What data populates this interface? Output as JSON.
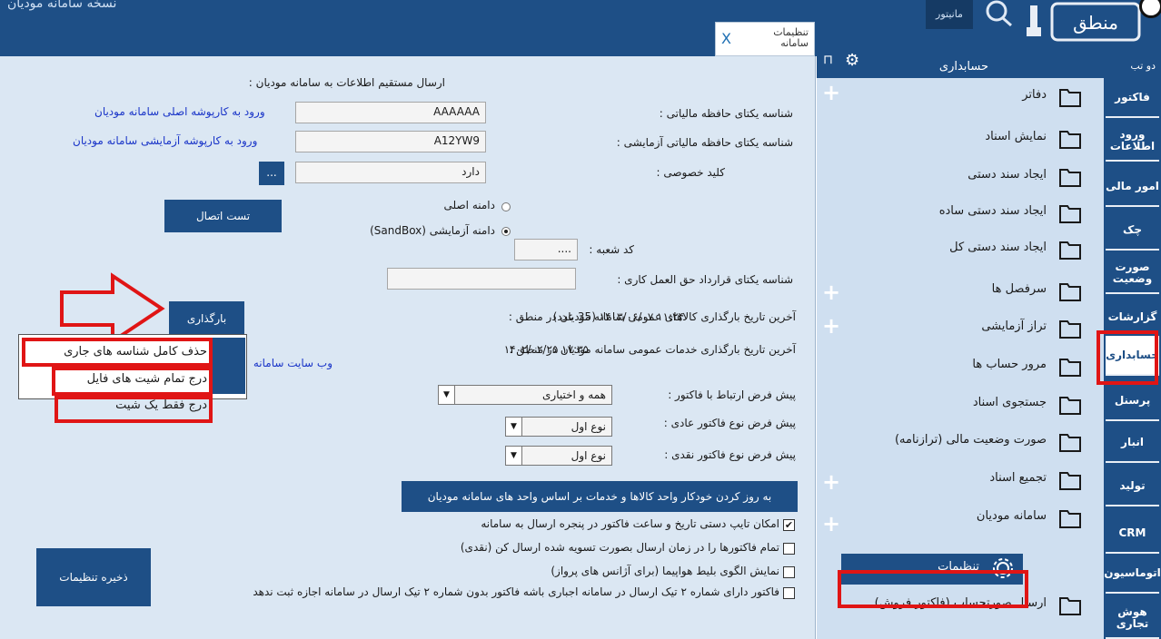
{
  "window": {
    "title": "نسخه سامانه مودیان"
  },
  "tab": {
    "label": "تنظیمات سامانه",
    "close": "X"
  },
  "header": {
    "monitor_label": "مانیتور",
    "logo_text": "منطق"
  },
  "form": {
    "section_title": "ارسال مستقیم اطلاعات به سامانه مودیان :",
    "main_id_label": "شناسه یکتای حافظه مالیاتی :",
    "main_id_value": "AAAAAA",
    "main_link": "ورود به کارپوشه اصلی سامانه مودیان",
    "test_id_label": "شناسه یکتای حافظه مالیاتی آزمایشی :",
    "test_id_value": "A12YW9",
    "test_link": "ورود به کارپوشه آزمایشی سامانه مودیان",
    "private_key_label": "کلید خصوصی :",
    "private_key_value": "دارد",
    "browse_label": "...",
    "radio_main": "دامنه اصلی",
    "radio_sandbox": "دامنه آزمایشی (SandBox)",
    "test_connection": "تست اتصال",
    "branch_label": "کد شعبه :",
    "branch_value": "....",
    "contract_label": "شناسه یکتای قرارداد حق العمل کاری :",
    "upload_button": "بارگذاری",
    "goods_date_label": "آخرین تاریخ بارگذاری کالاهای عمومی سامانه مودیان در منطق :",
    "goods_date_value": "۱۱:۲۴ ۱۴۰۳/۰۶/۰۷ (35 عدد)",
    "services_date_label": "آخرین تاریخ بارگذاری خدمات عمومی سامانه مودیان در منطق :",
    "services_date_value": "۱۷:۳۵ ۱۴۰۲/۰۲/۲۵",
    "website_link": "وب سایت سامانه",
    "default_link_label": "پیش فرض ارتباط با فاکتور :",
    "default_link_value": "همه و اختیاری",
    "default_normal_label": "پیش فرض نوع فاکتور عادی :",
    "default_normal_value": "نوع اول",
    "default_cash_label": "پیش فرض نوع فاکتور نقدی :",
    "default_cash_value": "نوع اول",
    "update_units_button": "به روز کردن خودکار واحد کالاها و خدمات بر اساس واحد های سامانه مودیان",
    "checkboxes": [
      {
        "label": "امکان تایپ دستی تاریخ و ساعت فاکتور در پنجره ارسال به سامانه",
        "checked": true
      },
      {
        "label": "تمام فاکتورها را در زمان ارسال بصورت تسویه شده ارسال کن (نقدی)",
        "checked": false
      },
      {
        "label": "نمایش الگوی بلیط هواپیما (برای آژانس های پرواز)",
        "checked": false
      },
      {
        "label": "فاکتور دارای شماره ۲ تیک ارسال در سامانه اجباری باشه فاکتور بدون شماره ۲ تیک ارسال در سامانه اجازه ثبت ندهد",
        "checked": false
      }
    ],
    "save_button": "ذخیره تنظیمات"
  },
  "popup": {
    "items": [
      "حذف کامل شناسه های جاری",
      "درج تمام شیت های فایل",
      "درج فقط یک شیت"
    ]
  },
  "sidebar": {
    "header_title": "حسابداری",
    "items": [
      {
        "label": "دفاتر"
      },
      {
        "label": "نمایش اسناد"
      },
      {
        "label": "ایجاد سند دستی"
      },
      {
        "label": "ایجاد سند دستی ساده"
      },
      {
        "label": "ایجاد سند دستی کل"
      },
      {
        "label": "سرفصل ها"
      },
      {
        "label": "تراز آزمایشی"
      },
      {
        "label": "مرور حساب ها"
      },
      {
        "label": "جستجوی اسناد"
      },
      {
        "label": "صورت وضعیت مالی (ترازنامه)"
      },
      {
        "label": "تجمیع اسناد"
      },
      {
        "label": "سامانه مودیان"
      },
      {
        "label": "تنظیمات"
      },
      {
        "label": "ارسال صورتحساب (فاکتور فروش)"
      }
    ]
  },
  "rail": {
    "toggle_label": "دو تب",
    "tabs": [
      "فاکتور",
      "ورود اطلاعات",
      "امور مالی",
      "چک",
      "صورت وضعیت",
      "گزارشات",
      "حسابداری",
      "پرسنل",
      "انبار",
      "تولید",
      "CRM",
      "اتوماسیون",
      "هوش تجاری"
    ]
  },
  "colors": {
    "accent": "#1e4f86",
    "highlight": "#e01515",
    "panel": "#dbe7f3"
  }
}
